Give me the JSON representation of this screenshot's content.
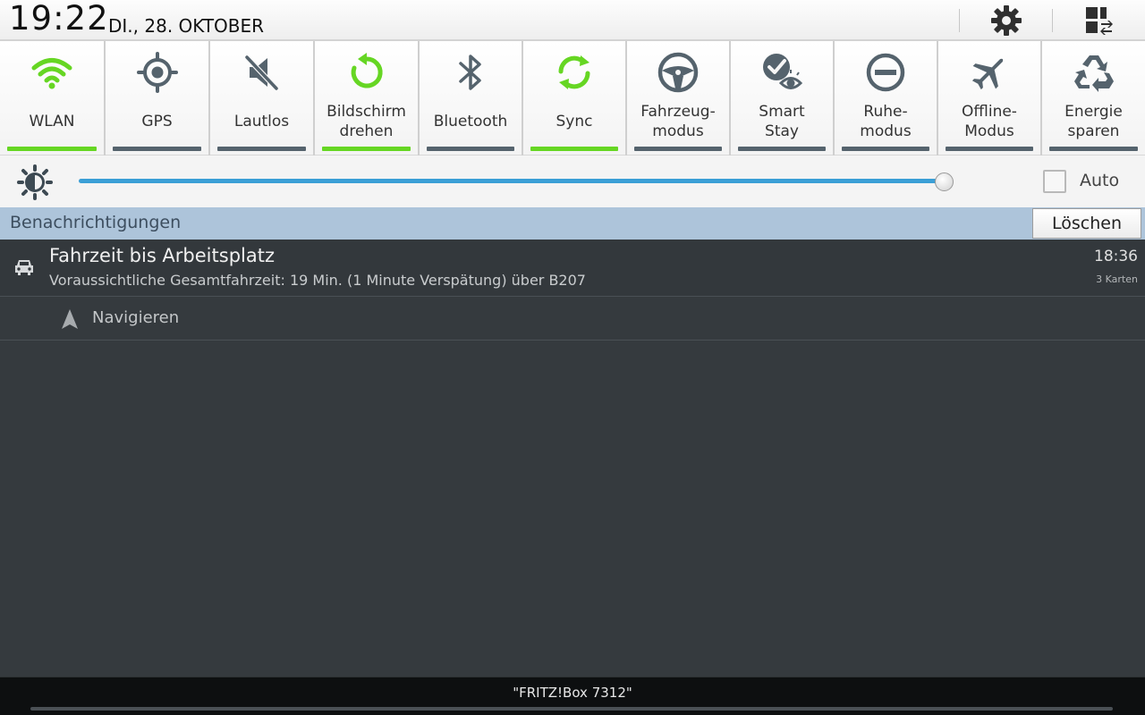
{
  "header": {
    "time": "19:22",
    "date": "DI., 28. OKTOBER"
  },
  "toggles": [
    {
      "label": "WLAN",
      "icon": "wifi-icon",
      "active": true
    },
    {
      "label": "GPS",
      "icon": "gps-icon",
      "active": false
    },
    {
      "label": "Lautlos",
      "icon": "mute-icon",
      "active": false
    },
    {
      "label": "Bildschirm\ndrehen",
      "icon": "rotate-icon",
      "active": true
    },
    {
      "label": "Bluetooth",
      "icon": "bluetooth-icon",
      "active": false
    },
    {
      "label": "Sync",
      "icon": "sync-icon",
      "active": true
    },
    {
      "label": "Fahrzeug-\nmodus",
      "icon": "steering-wheel-icon",
      "active": false
    },
    {
      "label": "Smart\nStay",
      "icon": "smart-stay-icon",
      "active": false
    },
    {
      "label": "Ruhe-\nmodus",
      "icon": "do-not-disturb-icon",
      "active": false
    },
    {
      "label": "Offline-\nModus",
      "icon": "airplane-icon",
      "active": false
    },
    {
      "label": "Energie\nsparen",
      "icon": "recycle-icon",
      "active": false
    }
  ],
  "brightness": {
    "level": 0.99,
    "auto_label": "Auto",
    "auto_checked": false
  },
  "notifications": {
    "header": "Benachrichtigungen",
    "clear_label": "Löschen",
    "items": [
      {
        "title": "Fahrzeit bis Arbeitsplatz",
        "text": "Voraussichtliche Gesamtfahrzeit: 19 Min. (1 Minute Verspätung) über B207",
        "time": "18:36",
        "cards": "3 Karten",
        "icon": "car-icon",
        "action_label": "Navigieren",
        "action_icon": "navigation-arrow-icon"
      }
    ]
  },
  "footer": {
    "network": "\"FRITZ!Box 7312\""
  },
  "colors": {
    "active_bar": "#66d623",
    "inactive_bar": "#55636d",
    "icon_gray": "#55636d",
    "icon_green": "#66d623",
    "slider": "#3b9fd6",
    "notif_header_bg": "#adc4da",
    "panel_bg": "#353a3e"
  }
}
